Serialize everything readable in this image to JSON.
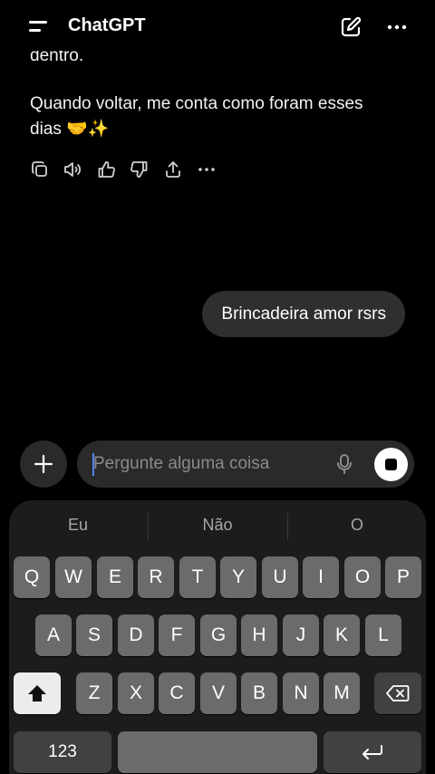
{
  "header": {
    "title": "ChatGPT"
  },
  "conversation": {
    "assistant_line_1": "dentro.",
    "assistant_line_2a": "Quando voltar, me conta como foram esses",
    "assistant_line_2b": "dias 🤝✨",
    "user_message": "Brincadeira amor rsrs"
  },
  "composer": {
    "placeholder": "Pergunte alguma coisa"
  },
  "keyboard": {
    "suggestions": [
      "Eu",
      "Não",
      "O"
    ],
    "row1": [
      "Q",
      "W",
      "E",
      "R",
      "T",
      "Y",
      "U",
      "I",
      "O",
      "P"
    ],
    "row2": [
      "A",
      "S",
      "D",
      "F",
      "G",
      "H",
      "J",
      "K",
      "L"
    ],
    "row3": [
      "Z",
      "X",
      "C",
      "V",
      "B",
      "N",
      "M"
    ],
    "numbers_key": "123"
  }
}
